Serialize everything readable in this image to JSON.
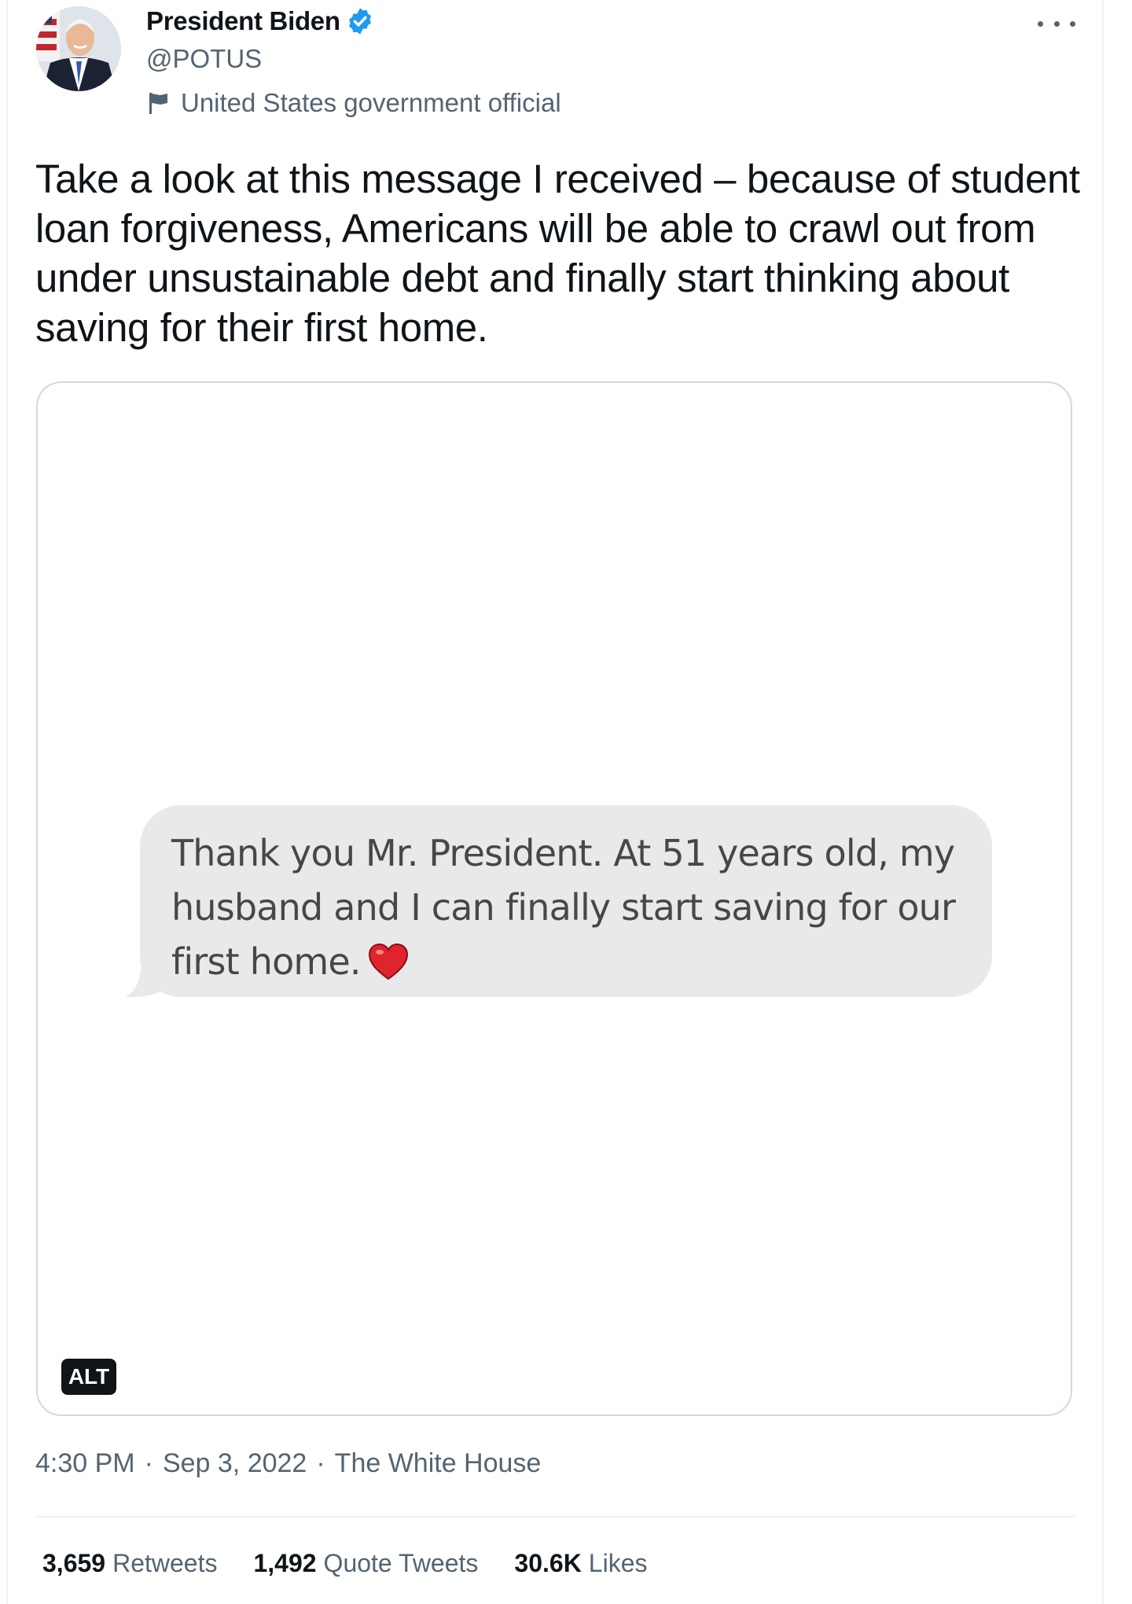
{
  "author": {
    "display_name": "President Biden",
    "handle": "@POTUS",
    "label": "United States government official",
    "verified": true
  },
  "tweet": {
    "text": "Take a look at this message I received – because of student loan forgiveness, Americans will be able to crawl out from under unsustainable debt and finally start thinking about saving for their first home."
  },
  "media": {
    "message_text": "Thank you Mr. President. At 51 years old, my husband and I can finally start saving for our first home.",
    "alt_badge": "ALT"
  },
  "meta": {
    "time": "4:30 PM",
    "date": "Sep 3, 2022",
    "source": "The White House",
    "separator": "·"
  },
  "stats": [
    {
      "count": "3,659",
      "label": "Retweets"
    },
    {
      "count": "1,492",
      "label": "Quote Tweets"
    },
    {
      "count": "30.6K",
      "label": "Likes"
    }
  ],
  "colors": {
    "verified_blue": "#1d9bf0",
    "text_primary": "#0f1419",
    "text_secondary": "#536471",
    "bubble_gray": "#e9e9eb",
    "heart_red": "#e0242e"
  },
  "icons": {
    "more": "more-horizontal-icon",
    "verified": "verified-badge-icon",
    "label": "flag-icon",
    "emoji": "red-heart-emoji"
  }
}
